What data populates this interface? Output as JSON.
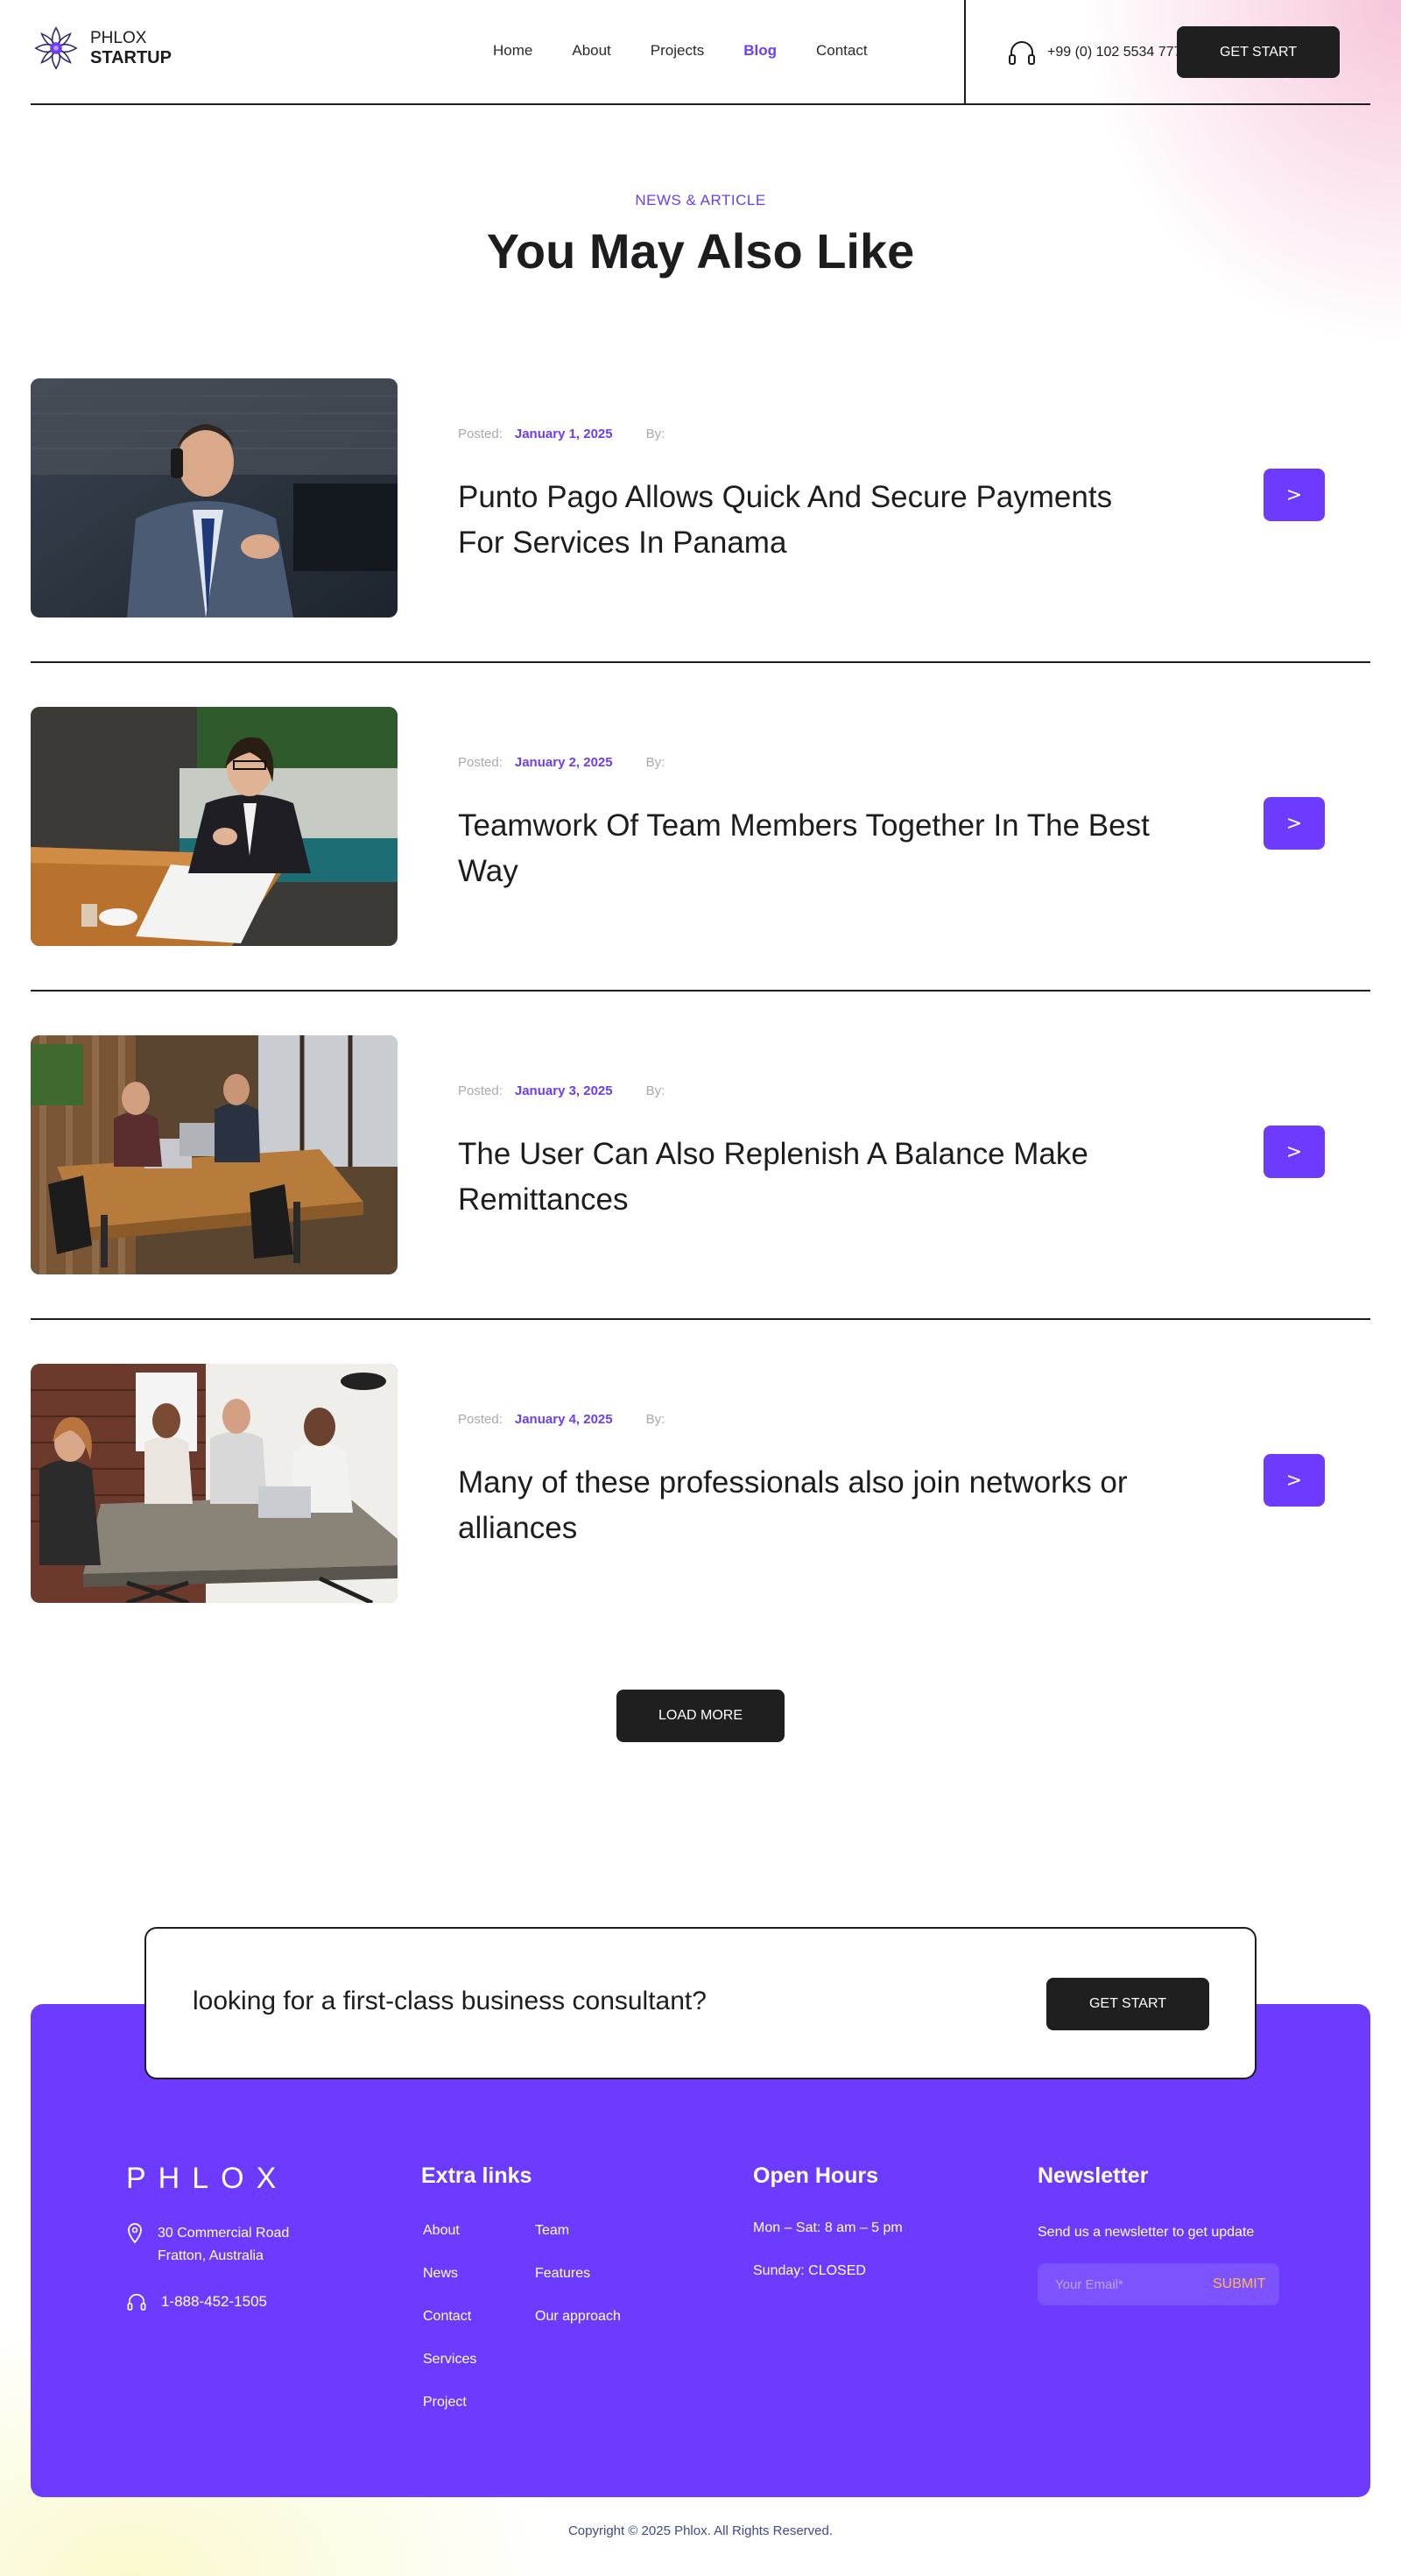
{
  "header": {
    "logo_line1": "PHLOX",
    "logo_line2": "STARTUP",
    "nav": [
      "Home",
      "About",
      "Projects",
      "Blog",
      "Contact"
    ],
    "active_nav": "Blog",
    "phone": "+99 (0) 102 5534 777",
    "cta": "GET START"
  },
  "section": {
    "eyebrow": "NEWS & ARTICLE",
    "title": "You May Also Like"
  },
  "posts": [
    {
      "posted_label": "Posted:",
      "date": "January 1, 2025",
      "by_label": "By:",
      "title": "Punto Pago Allows Quick And Secure Payments For Services In Panama",
      "arrow": ">"
    },
    {
      "posted_label": "Posted:",
      "date": "January 2, 2025",
      "by_label": "By:",
      "title": "Teamwork Of Team Members Together In The Best Way",
      "arrow": ">"
    },
    {
      "posted_label": "Posted:",
      "date": "January 3, 2025",
      "by_label": "By:",
      "title": "The User Can Also Replenish A Balance Make Remittances",
      "arrow": ">"
    },
    {
      "posted_label": "Posted:",
      "date": "January 4, 2025",
      "by_label": "By:",
      "title": "Many of these professionals also join networks or alliances",
      "arrow": ">"
    }
  ],
  "load_more": "LOAD MORE",
  "cta_card": {
    "text": "looking for a first-class business consultant?",
    "button": "GET START"
  },
  "footer": {
    "logo": "PHLOX",
    "address_line1": "30 Commercial Road",
    "address_line2": "Fratton, Australia",
    "phone": "1-888-452-1505",
    "extra_links_title": "Extra links",
    "links_col1": [
      "About",
      "News",
      "Contact",
      "Services",
      "Project"
    ],
    "links_col2": [
      "Team",
      "Features",
      "Our approach"
    ],
    "hours_title": "Open Hours",
    "hours_line1": "Mon – Sat: 8 am – 5 pm",
    "hours_line2": "Sunday: CLOSED",
    "newsletter_title": "Newsletter",
    "newsletter_sub": "Send us a newsletter to get update",
    "email_placeholder": "Your Email*",
    "submit": "SUBMIT",
    "copyright": "Copyright © 2025 Phlox. All Rights Reserved."
  },
  "colors": {
    "accent": "#6c3bff",
    "dark": "#1f1f1f",
    "submit": "#ffb84d"
  },
  "icons": [
    "flower-logo-icon",
    "headset-icon",
    "map-pin-icon",
    "arrow-right-icon"
  ]
}
